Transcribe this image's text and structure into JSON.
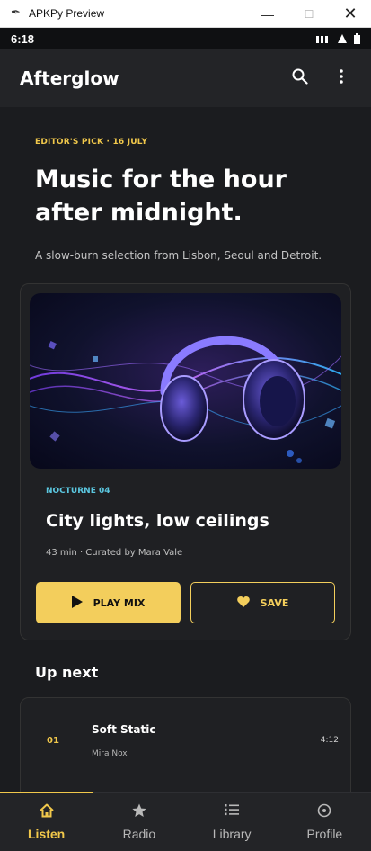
{
  "window": {
    "title": "APKPy Preview",
    "minimize": "—",
    "maximize": "☐",
    "close": "✕"
  },
  "status_bar": {
    "time": "6:18"
  },
  "app_bar": {
    "title": "Afterglow",
    "search_icon": "search-icon",
    "menu_icon": "more-vert-icon"
  },
  "hero": {
    "kicker": "EDITOR'S PICK · 16 JULY",
    "headline": "Music for the hour after midnight.",
    "subline": "A slow-burn selection from Lisbon, Seoul and Detroit."
  },
  "feature_card": {
    "tag": "NOCTURNE 04",
    "title": "City lights, low ceilings",
    "meta": "43 min · Curated by Mara Vale",
    "play_label": "PLAY MIX",
    "save_label": "SAVE"
  },
  "up_next": {
    "title": "Up next",
    "tracks": [
      {
        "number": "01",
        "title": "Soft Static",
        "artist": "Mira Nox",
        "duration": "4:12"
      }
    ]
  },
  "bottom_nav": {
    "items": [
      {
        "label": "Listen",
        "icon": "home-icon",
        "active": true
      },
      {
        "label": "Radio",
        "icon": "star-icon",
        "active": false
      },
      {
        "label": "Library",
        "icon": "list-icon",
        "active": false
      },
      {
        "label": "Profile",
        "icon": "profile-icon",
        "active": false
      }
    ]
  },
  "colors": {
    "accent": "#f3ce5c",
    "tag": "#5bc7e0",
    "background": "#1b1c1f"
  }
}
